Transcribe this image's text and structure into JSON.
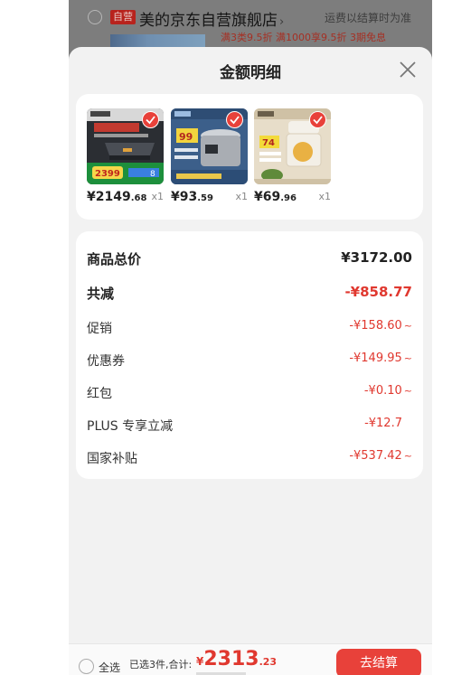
{
  "store": {
    "badge": "自营",
    "name": "美的京东自营旗舰店",
    "arrow": "›",
    "shipping_note": "运费以结算时为准",
    "promo": "满3类9.5折 满1000享9.5折 3期免息"
  },
  "sheet": {
    "title": "金额明细",
    "close_icon": "close-icon"
  },
  "products": [
    {
      "name_icon": "range-hood-image",
      "price_main": "¥2149",
      "price_dec": ".68",
      "qty": "x1"
    },
    {
      "name_icon": "pressure-cooker-image",
      "price_main": "¥93",
      "price_dec": ".59",
      "qty": "x1"
    },
    {
      "name_icon": "food-processor-image",
      "price_main": "¥69",
      "price_dec": ".96",
      "qty": "x1"
    }
  ],
  "totals": {
    "goods_total_label": "商品总价",
    "goods_total_value": "¥3172.00",
    "total_discount_label": "共减",
    "total_discount_value": "-¥858.77",
    "promotion_label": "促销",
    "promotion_value": "-¥158.60",
    "coupon_label": "优惠券",
    "coupon_value": "-¥149.95",
    "red_packet_label": "红包",
    "red_packet_value": "-¥0.10",
    "plus_label": "PLUS 专享立减",
    "plus_value": "-¥12.7",
    "subsidy_label": "国家补贴",
    "subsidy_value": "-¥537.42",
    "expand_glyph": "~"
  },
  "bottom_bar": {
    "select_all_label": "全选",
    "selected_text": "已选3件,合计:",
    "total_currency": "¥",
    "total_main": "2313",
    "total_dec": ".23",
    "checkout_label": "去结算"
  },
  "colors": {
    "accent": "#e8413a",
    "discount_text": "#e0382f",
    "overlay": "#7d7d7d",
    "sheet_bg": "#f2f2f2"
  }
}
